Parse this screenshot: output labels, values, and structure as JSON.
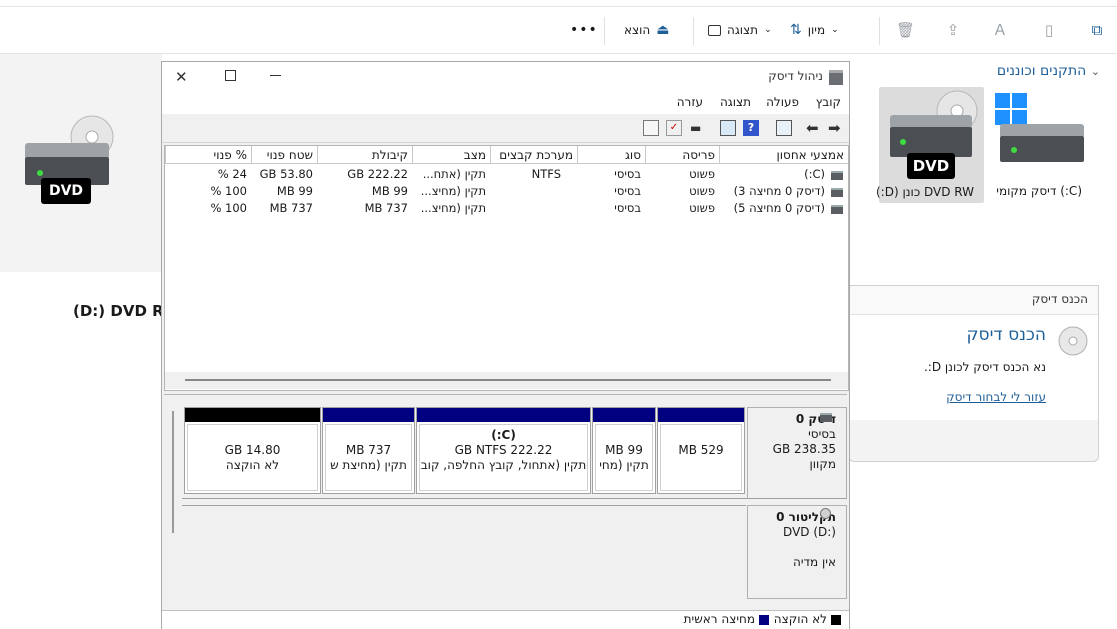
{
  "explorer": {
    "toolbar": {
      "more_label": "•••",
      "eject_label": "הוצא",
      "view_label": "תצוגה",
      "sort_label": "מיון"
    },
    "section_title": "התקנים וכוננים",
    "drives": [
      {
        "name": "(C:) דיסק מקומי"
      },
      {
        "name": "DVD RW כונן (D:)",
        "badge": "DVD"
      }
    ],
    "left_badge": "DVD",
    "left_drive_label": "(D:) DVD RW"
  },
  "insert_disk": {
    "title_bar": "הכנס דיסק",
    "heading": "הכנס דיסק",
    "message": "נא הכנס דיסק לכונן D:.",
    "help_link": "עזור לי לבחור דיסק"
  },
  "disk_mgmt": {
    "title": "ניהול דיסק",
    "menu": [
      "קובץ",
      "פעולה",
      "תצוגה",
      "עזרה"
    ],
    "columns": [
      "אמצעי אחסון",
      "פריסה",
      "סוג",
      "מערכת קבצים",
      "מצב",
      "קיבולת",
      "שטח פנוי",
      "% פנוי"
    ],
    "rows": [
      [
        "(C:)",
        "פשוט",
        "בסיסי",
        "NTFS",
        "תקין (אתח...",
        "GB 222.22",
        "GB 53.80",
        "24 %"
      ],
      [
        "(דיסק 0 מחיצה 3)",
        "פשוט",
        "בסיסי",
        "",
        "תקין (מחיצ...",
        "MB 99",
        "MB 99",
        "100 %"
      ],
      [
        "(דיסק 0 מחיצה 5)",
        "פשוט",
        "בסיסי",
        "",
        "תקין (מחיצ...",
        "MB 737",
        "MB 737",
        "100 %"
      ]
    ],
    "disk0": {
      "name": "דיסק 0",
      "type": "בסיסי",
      "size": "GB 238.35",
      "status": "מקוון",
      "partitions": [
        {
          "line1": "MB 529",
          "line2": ""
        },
        {
          "line1": "MB 99",
          "line2": "תקין (מחי"
        },
        {
          "line1": "(C:)",
          "line2": "GB NTFS 222.22",
          "line3": "תקין (אתחול, קובץ החלפה, קוב"
        },
        {
          "line1": "MB 737",
          "line2": "תקין (מחיצת ש"
        },
        {
          "line1": "GB 14.80",
          "line2": "לא הוקצה"
        }
      ]
    },
    "cdrom0": {
      "name": "תקליטור 0",
      "type": "DVD (D:)",
      "status": "אין מדיה"
    },
    "legend": {
      "unallocated": "לא הוקצה",
      "primary": "מחיצה ראשית"
    }
  },
  "colors": {
    "primary_partition": "#000080",
    "unallocated": "#000000",
    "link": "#1f5f99"
  }
}
